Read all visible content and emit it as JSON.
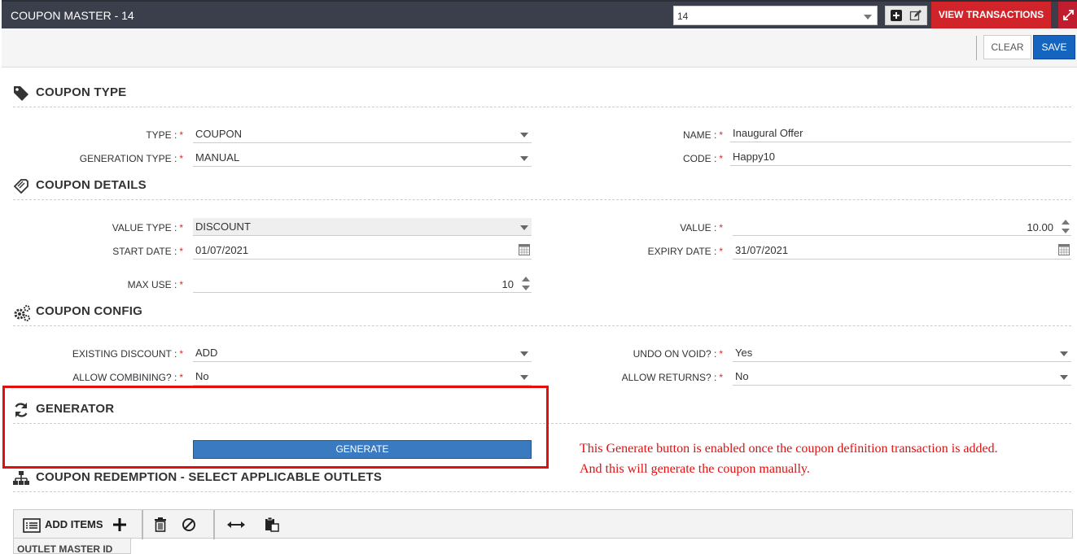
{
  "window": {
    "title": "COUPON MASTER - 14",
    "record_select": "14",
    "view_transactions": "VIEW TRANSACTIONS"
  },
  "toolbar": {
    "clear": "CLEAR",
    "save": "SAVE"
  },
  "coupon_type": {
    "heading": "COUPON TYPE",
    "type_label": "TYPE :",
    "type_value": "COUPON",
    "gen_type_label": "GENERATION TYPE :",
    "gen_type_value": "MANUAL",
    "name_label": "NAME :",
    "name_value": "Inaugural Offer",
    "code_label": "CODE :",
    "code_value": "Happy10"
  },
  "coupon_details": {
    "heading": "COUPON DETAILS",
    "value_type_label": "VALUE TYPE :",
    "value_type_value": "DISCOUNT",
    "start_date_label": "START DATE :",
    "start_date_value": "01/07/2021",
    "max_use_label": "MAX USE :",
    "max_use_value": "10",
    "value_label": "VALUE :",
    "value_value": "10.00",
    "expiry_date_label": "EXPIRY DATE :",
    "expiry_date_value": "31/07/2021"
  },
  "coupon_config": {
    "heading": "COUPON CONFIG",
    "existing_discount_label": "EXISTING DISCOUNT :",
    "existing_discount_value": "ADD",
    "allow_combining_label": "ALLOW COMBINING? :",
    "allow_combining_value": "No",
    "undo_on_void_label": "UNDO ON VOID? :",
    "undo_on_void_value": "Yes",
    "allow_returns_label": "ALLOW RETURNS? :",
    "allow_returns_value": "No"
  },
  "generator": {
    "heading": "GENERATOR",
    "button": "GENERATE",
    "note_line1": "This Generate button is enabled once the coupon definition transaction is added.",
    "note_line2": "And this will generate the coupon manually."
  },
  "redemption": {
    "heading": "COUPON REDEMPTION - SELECT APPLICABLE OUTLETS",
    "add_items": "ADD ITEMS",
    "column_outlet": "OUTLET MASTER ID"
  },
  "required_mark": "*"
}
